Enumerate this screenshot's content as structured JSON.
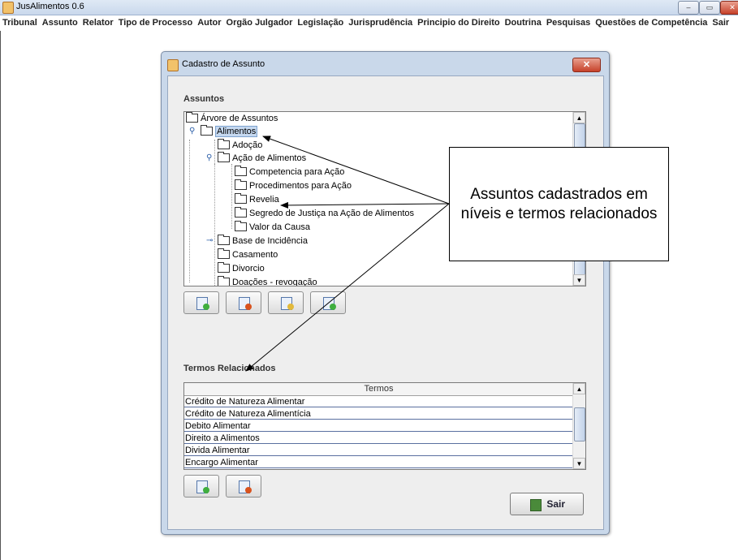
{
  "app": {
    "title": "JusAlimentos 0.6",
    "window_controls": {
      "minimize": "–",
      "maximize": "▭",
      "close": "✕"
    }
  },
  "menu": [
    "Tribunal",
    "Assunto",
    "Relator",
    "Tipo de Processo",
    "Autor",
    "Orgão Julgador",
    "Legislação",
    "Jurisprudência",
    "Principio do Direito",
    "Doutrina",
    "Pesquisas",
    "Questões de Competência",
    "Sair"
  ],
  "dialog": {
    "title": "Cadastro de Assunto",
    "close_label": "✕",
    "assuntos_label": "Assuntos",
    "tree": [
      {
        "label": "Árvore de Assuntos"
      },
      {
        "label": "Alimentos"
      },
      {
        "label": "Adoção"
      },
      {
        "label": "Ação de Alimentos"
      },
      {
        "label": "Competencia para Ação"
      },
      {
        "label": "Procedimentos para Ação"
      },
      {
        "label": "Revelia"
      },
      {
        "label": "Segredo de Justiça na Ação de Alimentos"
      },
      {
        "label": "Valor da Causa"
      },
      {
        "label": "Base de Incidência"
      },
      {
        "label": "Casamento"
      },
      {
        "label": "Divorcio"
      },
      {
        "label": "Doações - revogação"
      }
    ],
    "tree_buttons": [
      {
        "icon": "add-doc-icon",
        "color": "#3fae3f"
      },
      {
        "icon": "remove-doc-icon",
        "color": "#d9531e"
      },
      {
        "icon": "edit-doc-icon",
        "color": "#e2b93b"
      },
      {
        "icon": "export-doc-icon",
        "color": "#3fae3f"
      }
    ],
    "termos_label": "Termos Relacionados",
    "termos_header": "Termos",
    "termos": [
      "Crédito de Natureza Alimentar",
      "Crédito de Natureza Alimentícia",
      "Debito Alimentar",
      "Direito a Alimentos",
      "Divida Alimentar",
      "Encargo Alimentar"
    ],
    "termos_buttons": [
      {
        "icon": "add-doc-icon",
        "color": "#3fae3f"
      },
      {
        "icon": "remove-doc-icon",
        "color": "#d9531e"
      }
    ],
    "exit_label": "Sair"
  },
  "callout": {
    "text": "Assuntos cadastrados em níveis e termos relacionados"
  }
}
